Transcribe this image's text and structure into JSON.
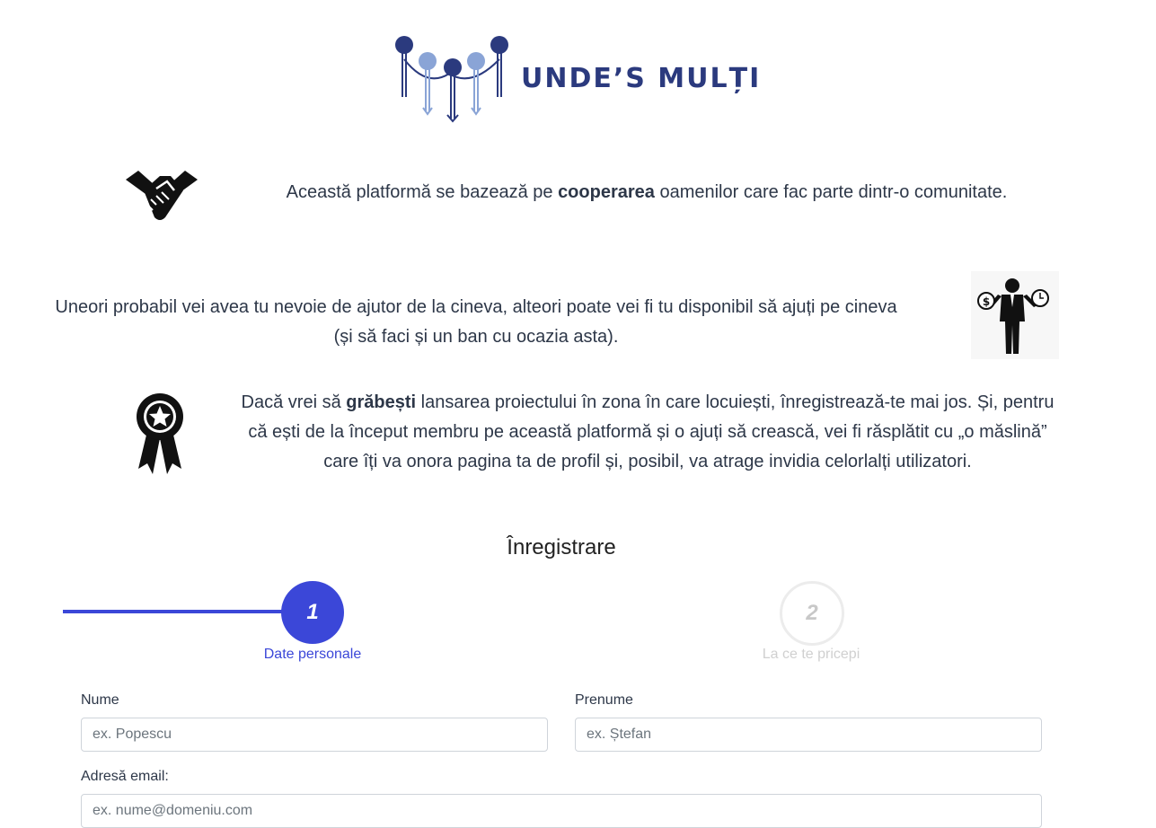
{
  "logo": {
    "text": "UNDE’S MULȚI"
  },
  "intro": {
    "p1_before": "Această platformă se bazează pe ",
    "p1_strong": "cooperarea",
    "p1_after": " oamenilor care fac parte dintr-o comunitate.",
    "p2": "Uneori probabil vei avea tu nevoie de ajutor de la cineva, alteori poate vei fi tu disponibil să ajuți pe cineva (și să faci și un ban cu ocazia asta).",
    "p3_before": "Dacă vrei să ",
    "p3_strong": "grăbești",
    "p3_after": " lansarea proiectului în zona în care locuiești, înregistrează-te mai jos. Și, pentru că ești de la început membru pe această platformă și o ajuți să crească, vei fi răsplătit cu „o măslină” care îți va onora pagina ta de profil și, posibil, va atrage invidia celorlalți utilizatori."
  },
  "icons": [
    "handshake-icon",
    "person-balance-icon",
    "award-badge-icon"
  ],
  "registration": {
    "title": "Înregistrare",
    "steps": [
      {
        "number": "1",
        "label": "Date personale",
        "active": true
      },
      {
        "number": "2",
        "label": "La ce te pricepi",
        "active": false
      }
    ],
    "fields": {
      "nume": {
        "label": "Nume",
        "placeholder": "ex. Popescu",
        "value": ""
      },
      "prenume": {
        "label": "Prenume",
        "placeholder": "ex. Ștefan",
        "value": ""
      },
      "email": {
        "label": "Adresă email:",
        "placeholder": "ex. nume@domeniu.com",
        "value": ""
      }
    }
  },
  "colors": {
    "brand": "#2b3a7e",
    "accent": "#3b47d8",
    "inactive": "#d0d0d0"
  }
}
